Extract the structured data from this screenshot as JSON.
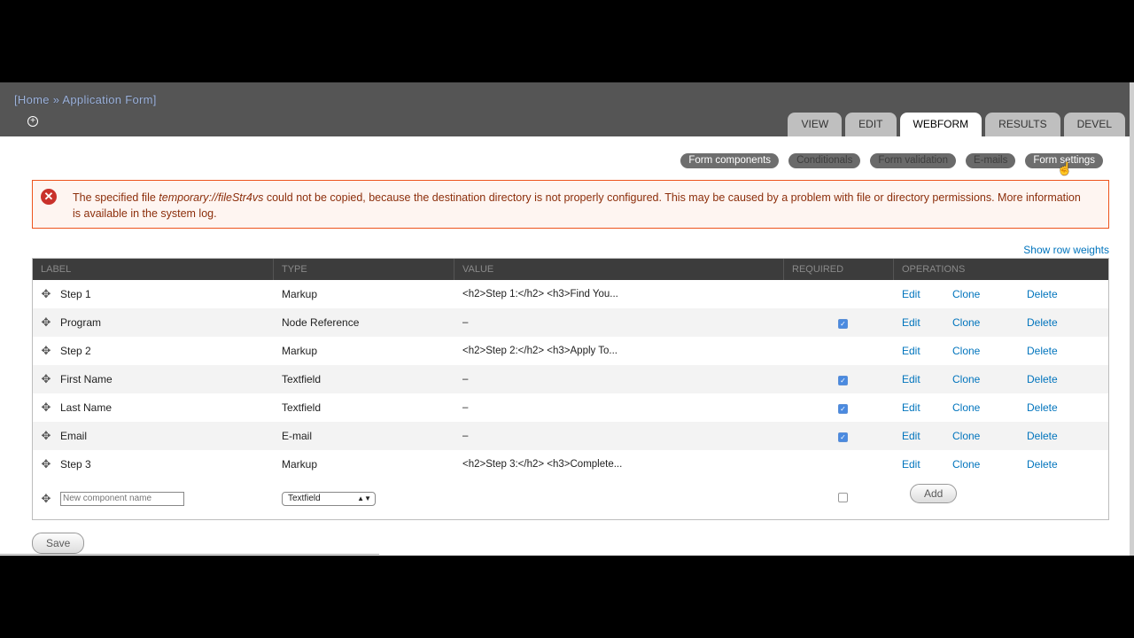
{
  "header": {
    "title": "[Home » Application Form]",
    "add_shortcut_icon": "plus-circle-icon",
    "tabs": [
      {
        "label": "VIEW",
        "active": false
      },
      {
        "label": "EDIT",
        "active": false
      },
      {
        "label": "WEBFORM",
        "active": true
      },
      {
        "label": "RESULTS",
        "active": false
      },
      {
        "label": "DEVEL",
        "active": false
      }
    ]
  },
  "secondary_tabs": [
    {
      "label": "Form components"
    },
    {
      "label": "Conditionals"
    },
    {
      "label": "Form validation"
    },
    {
      "label": "E-mails"
    },
    {
      "label": "Form settings"
    }
  ],
  "error": {
    "icon": "error-x-icon",
    "text_before": "The specified file ",
    "file": "temporary://fileStr4vs",
    "text_after": " could not be copied, because the destination directory is not properly configured. This may be caused by a problem with file or directory permissions. More information is available in the system log."
  },
  "show_row_weights": "Show row weights",
  "table": {
    "headers": [
      "LABEL",
      "TYPE",
      "VALUE",
      "REQUIRED",
      "OPERATIONS"
    ],
    "rows": [
      {
        "label": "Step 1",
        "type": "Markup",
        "value": "<h2>Step 1:</h2> <h3>Find You...",
        "required": false,
        "edit": "Edit",
        "clone": "Clone",
        "delete": "Delete"
      },
      {
        "label": "Program",
        "type": "Node Reference",
        "value": "–",
        "required": true,
        "edit": "Edit",
        "clone": "Clone",
        "delete": "Delete"
      },
      {
        "label": "Step 2",
        "type": "Markup",
        "value": "<h2>Step 2:</h2> <h3>Apply To...",
        "required": false,
        "edit": "Edit",
        "clone": "Clone",
        "delete": "Delete"
      },
      {
        "label": "First Name",
        "type": "Textfield",
        "value": "–",
        "required": true,
        "edit": "Edit",
        "clone": "Clone",
        "delete": "Delete"
      },
      {
        "label": "Last Name",
        "type": "Textfield",
        "value": "–",
        "required": true,
        "edit": "Edit",
        "clone": "Clone",
        "delete": "Delete"
      },
      {
        "label": "Email",
        "type": "E-mail",
        "value": "–",
        "required": true,
        "edit": "Edit",
        "clone": "Clone",
        "delete": "Delete"
      },
      {
        "label": "Step 3",
        "type": "Markup",
        "value": "<h2>Step 3:</h2> <h3>Complete...",
        "required": false,
        "edit": "Edit",
        "clone": "Clone",
        "delete": "Delete"
      }
    ],
    "new_row": {
      "name_placeholder": "New component name",
      "type_selected": "Textfield",
      "required": false,
      "add_label": "Add"
    }
  },
  "save_label": "Save",
  "colors": {
    "error_border": "#ed541d",
    "error_text": "#8c2e0b",
    "link": "#0074bd",
    "header_bg": "#555555"
  }
}
